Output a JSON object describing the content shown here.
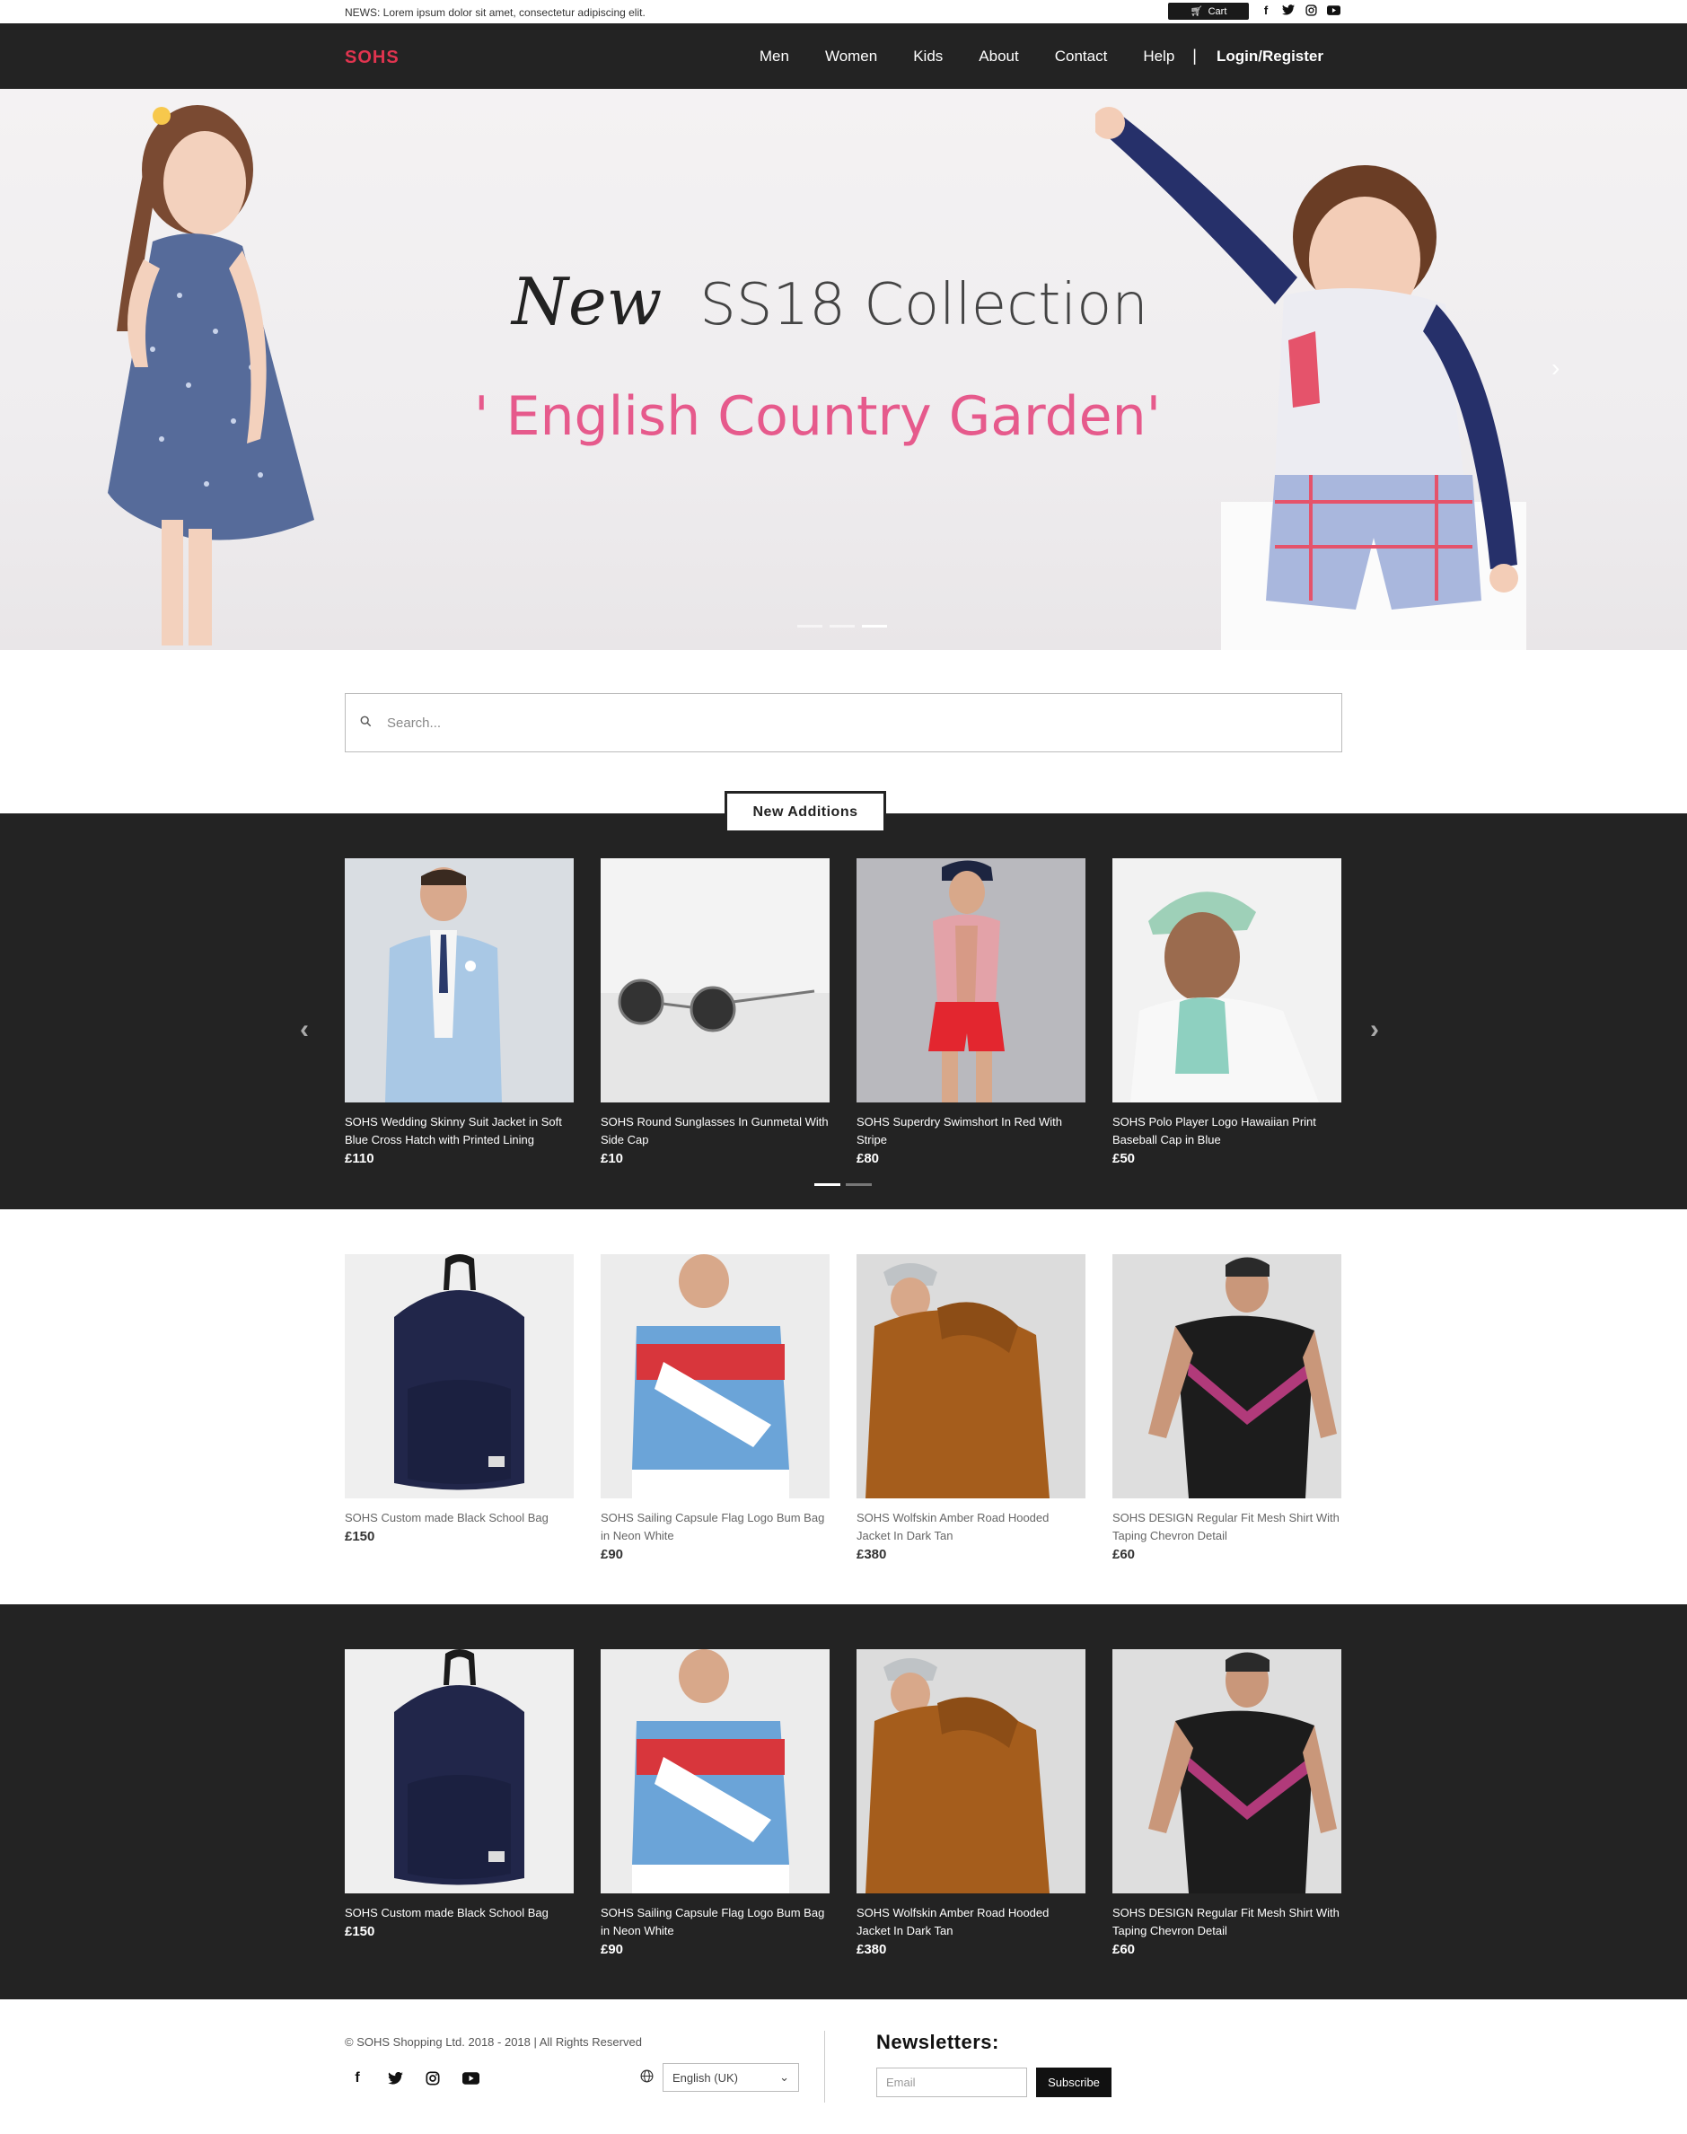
{
  "newsbar": {
    "text": "NEWS: Lorem ipsum dolor sit amet, consectetur adipiscing elit.",
    "cart_label": "Cart",
    "social_icons": [
      "facebook-icon",
      "twitter-icon",
      "instagram-icon",
      "youtube-icon"
    ]
  },
  "nav": {
    "logo": "SOHS",
    "items": [
      "Men",
      "Women",
      "Kids",
      "About",
      "Contact",
      "Help"
    ],
    "separator": "|",
    "login": "Login/Register"
  },
  "hero": {
    "new_word": "New",
    "collection": "SS18 Collection",
    "subtitle": "' English Country Garden'",
    "slide_count": 3,
    "active_slide": 3
  },
  "search": {
    "placeholder": "Search..."
  },
  "new_additions": {
    "label": "New Additions",
    "products": [
      {
        "title": "SOHS Wedding Skinny Suit Jacket in Soft Blue Cross Hatch with Printed Lining",
        "price": "£110"
      },
      {
        "title": "SOHS Round Sunglasses In Gunmetal With Side Cap",
        "price": "£10"
      },
      {
        "title": "SOHS Superdry Swimshort In Red With Stripe",
        "price": "£80"
      },
      {
        "title": "SOHS Polo Player Logo Hawaiian Print Baseball Cap in Blue",
        "price": "£50"
      }
    ],
    "page_count": 2,
    "active_page": 1
  },
  "section_two": {
    "products": [
      {
        "title": "SOHS Custom made Black School Bag",
        "price": "£150"
      },
      {
        "title": "SOHS Sailing Capsule Flag Logo Bum Bag in Neon White",
        "price": "£90"
      },
      {
        "title": "SOHS Wolfskin Amber Road Hooded Jacket In Dark Tan",
        "price": "£380"
      },
      {
        "title": "SOHS DESIGN Regular Fit Mesh Shirt With Taping Chevron Detail",
        "price": "£60"
      }
    ]
  },
  "section_three": {
    "products": [
      {
        "title": "SOHS Custom made Black School Bag",
        "price": "£150"
      },
      {
        "title": "SOHS Sailing Capsule Flag Logo Bum Bag in Neon White",
        "price": "£90"
      },
      {
        "title": "SOHS Wolfskin Amber Road Hooded Jacket In Dark Tan",
        "price": "£380"
      },
      {
        "title": "SOHS DESIGN Regular Fit Mesh Shirt With Taping Chevron Detail",
        "price": "£60"
      }
    ]
  },
  "footer": {
    "copyright": "© SOHS Shopping Ltd. 2018 - 2018 | All Rights Reserved",
    "language": "English (UK)",
    "newsletter_title": "Newsletters:",
    "email_placeholder": "Email",
    "subscribe_label": "Subscribe"
  },
  "colors": {
    "brand": "#e0344f",
    "dark": "#232323",
    "hero_subtitle": "#e65a8c"
  }
}
